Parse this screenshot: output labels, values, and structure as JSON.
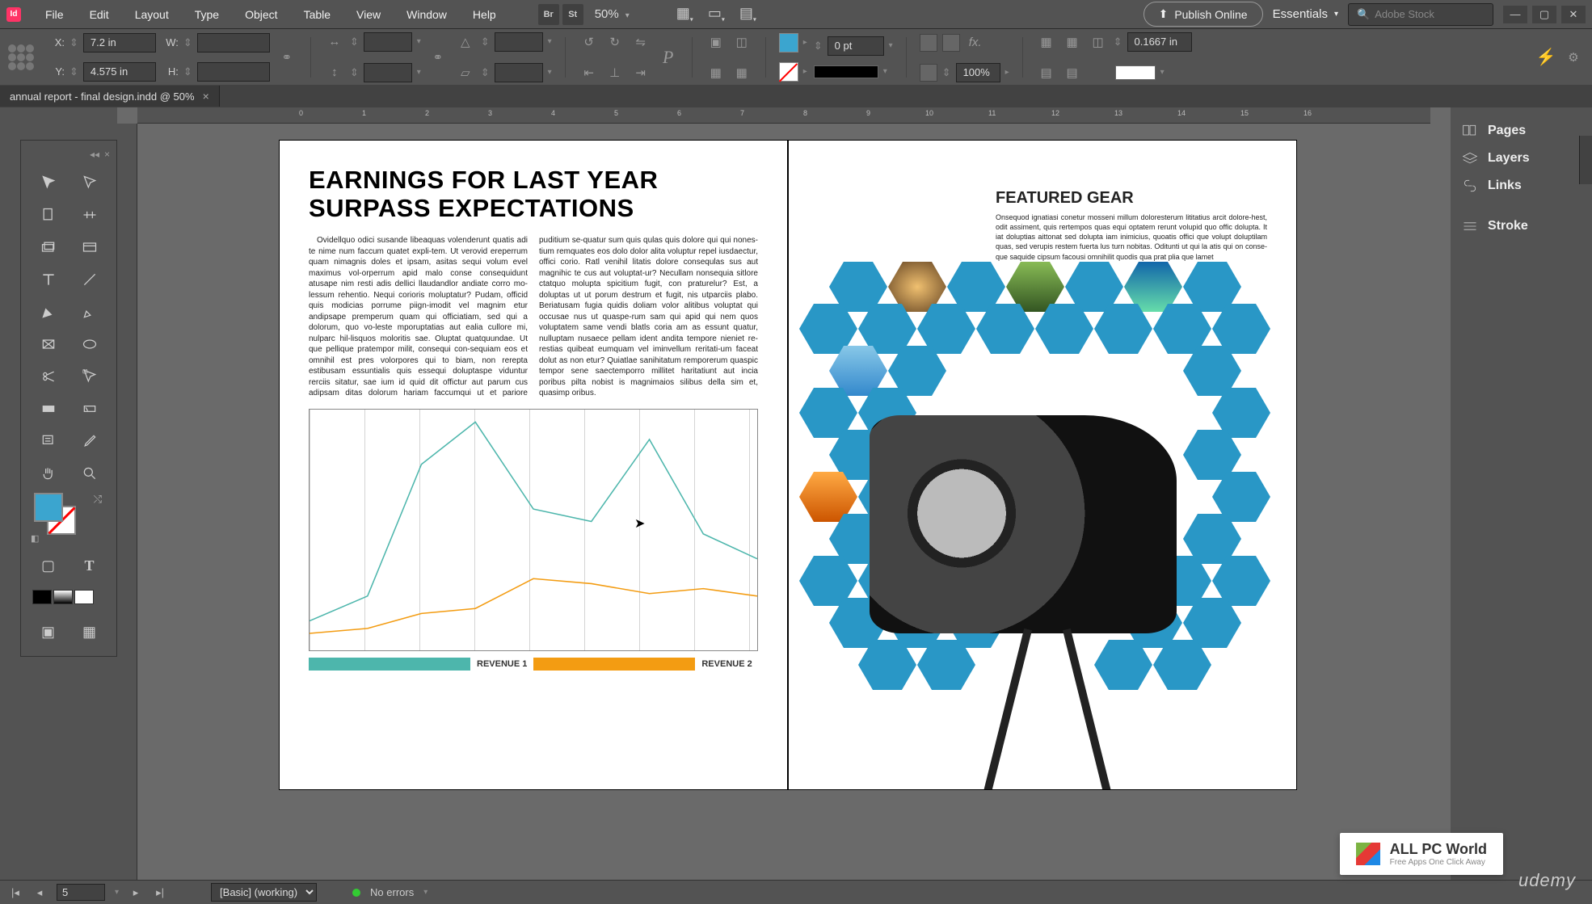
{
  "menu": {
    "items": [
      "File",
      "Edit",
      "Layout",
      "Type",
      "Object",
      "Table",
      "View",
      "Window",
      "Help"
    ],
    "br": "Br",
    "st": "St",
    "zoom": "50%",
    "publish": "Publish Online",
    "workspace": "Essentials",
    "search_placeholder": "Adobe Stock"
  },
  "control": {
    "x_label": "X:",
    "x_value": "7.2 in",
    "y_label": "Y:",
    "y_value": "4.575 in",
    "w_label": "W:",
    "w_value": "",
    "h_label": "H:",
    "h_value": "",
    "stroke_pt": "0 pt",
    "opacity": "100%",
    "leading": "0.1667 in"
  },
  "doc_tab": {
    "title": "annual report - final design.indd @ 50%"
  },
  "panels": [
    "Pages",
    "Layers",
    "Links",
    "Stroke"
  ],
  "status": {
    "page": "5",
    "preset": "[Basic] (working)",
    "errors": "No errors"
  },
  "page_left": {
    "headline": "EARNINGS FOR LAST YEAR SURPASS EXPECTATIONS",
    "body": "Ovidellquo odici susande libeaquas volenderunt quatis adi te nime num faccum quatet expli-tem. Ut verovid ereperrum quam nimagnis doles et ipsam, asitas sequi volum evel maximus vol-orperrum apid malo conse consequidunt atusape nim resti adis dellici llaudandlor andiate corro mo-lessum rehentio. Nequi corioris moluptatur?  Pudam, officid quis modicias porrume piign-imodit vel magnim etur andipsape premperum quam qui officiatiam, sed qui a dolorum, quo vo-leste mporuptatias aut ealia cullore mi, nulparc hil-lisquos moloritis sae. Oluptat quatquundae.  Ut que pellique pratempor milit, consequi con-sequiam eos et omnihil est pres volorpores qui to biam, non rerepta estibusam essuntialis quis essequi doluptaspe viduntur rerciis sitatur, sae ium id quid dit offictur aut parum cus adipsam ditas dolorum hariam faccumqui ut et pariore puditium se-quatur sum quis qulas quis dolore qui qui nones-tium remquates eos dolo dolor alita voluptur repel iusdaectur, offici corio. Ratl venihil litatis dolore consequlas sus aut magnihic te cus aut voluptat-ur?  Necullam nonsequia sitlore ctatquo molupta spicitium fugit, con praturelur?  Est, a doluptas ut ut porum destrum et fugit, nis utparciis plabo. Beriatusam fugia quidis doliam volor alitibus voluptat qui occusae nus ut quaspe-rum sam qui apid qui nem quos voluptatem same vendi blatls coria am as essunt quatur, nulluptam nusaece pellam ident andita tempore nieniet re-restias quibeat eumquam vel iminvellum reritati-um faceat dolut as non etur? Quiatlae sanihitatum remporerum quaspic tempor sene saectemporro millitet haritatiunt aut incia poribus pilta nobist is magnimaios silibus della sim et, quasimp oribus.",
    "legend1": "REVENUE 1",
    "legend2": "REVENUE 2"
  },
  "page_right": {
    "subhead": "FEATURED GEAR",
    "body": "Onsequod ignatiasi conetur mosseni millum doloresterum lititatius arcit dolore-hest, odit assiment, quis rertempos quas equi optatem rerunt volupid quo offic dolupta. It iat doluptias aittonat sed dolupta iam inimicius, quoatis offici que volupt doluptilam quas, sed verupis restem fuerta lus turn nobitas. Oditunti ut qui la atis qui on conse-que saquide cipsum facousi omnihilit quodis qua prat plia que lamet"
  },
  "ruler_marks": [
    "0",
    "1",
    "2",
    "3",
    "4",
    "5",
    "6",
    "7",
    "8",
    "9",
    "10",
    "11",
    "12",
    "13",
    "14",
    "15",
    "16"
  ],
  "chart_data": {
    "type": "line",
    "x": [
      0,
      1,
      2,
      3,
      4,
      5,
      6,
      7
    ],
    "series": [
      {
        "name": "REVENUE 1",
        "color": "#4db6ac",
        "values": [
          15,
          25,
          78,
          95,
          60,
          55,
          88,
          50
        ]
      },
      {
        "name": "REVENUE 2",
        "color": "#f39c12",
        "values": [
          10,
          12,
          18,
          20,
          32,
          30,
          26,
          28
        ]
      }
    ],
    "ylim": [
      0,
      100
    ]
  },
  "watermark": {
    "brand": "ALL PC World",
    "tagline": "Free Apps One Click Away",
    "udemy": "udemy"
  }
}
